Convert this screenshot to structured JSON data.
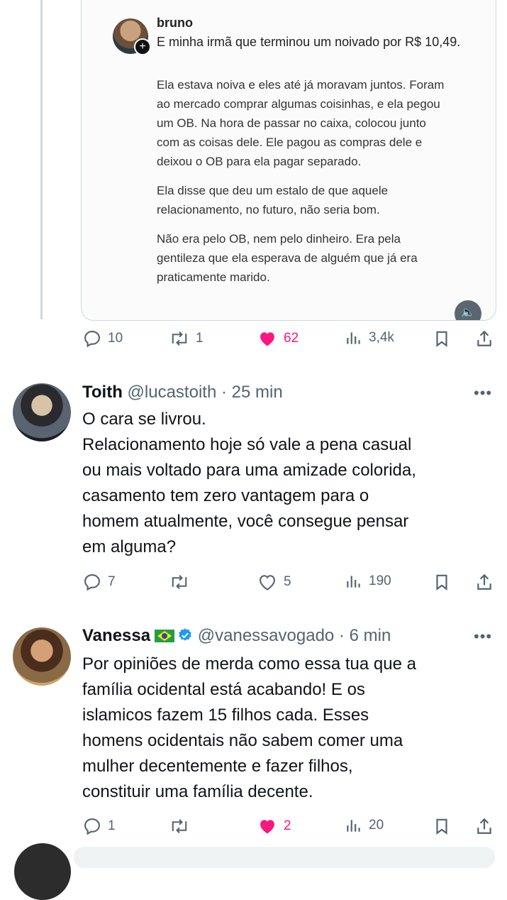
{
  "quoted": {
    "author": "bruno",
    "headline": "E minha irmã que terminou um noivado por R$ 10,49.",
    "paragraphs": [
      "Ela estava noiva e eles até já moravam juntos. Foram ao mercado comprar algumas coisinhas, e ela pegou um OB. Na hora de passar no caixa, colocou junto com as coisas dele. Ele pagou as compras dele e deixou o OB para ela pagar separado.",
      "Ela disse que deu um estalo de que aquele relacionamento, no futuro, não seria bom.",
      "Não era pelo OB, nem pelo dinheiro. Era pela gentileza que ela esperava de alguém que já era praticamente marido."
    ],
    "actions": {
      "replies": "10",
      "reposts": "1",
      "likes": "62",
      "views": "3,4k"
    }
  },
  "replies": [
    {
      "name": "Toith",
      "handle": "@lucastoith",
      "time": "· 25 min",
      "lines": [
        "O cara se livrou.",
        "Relacionamento hoje só vale a pena casual",
        "ou mais voltado para uma amizade colorida,",
        "casamento tem zero vantagem para o",
        "homem atualmente, você consegue pensar",
        "em alguma?"
      ],
      "actions": {
        "replies": "7",
        "reposts": "",
        "likes": "5",
        "views": "190"
      }
    },
    {
      "name": "Vanessa",
      "handle": "@vanessavogado",
      "time": "· 6 min",
      "lines": [
        "Por opiniões de merda como essa tua que a",
        "família ocidental está acabando! E os",
        "islamicos fazem 15 filhos cada. Esses",
        "homens ocidentais não sabem comer uma",
        "mulher decentemente e fazer filhos,",
        "constituir uma família decente."
      ],
      "actions": {
        "replies": "1",
        "reposts": "",
        "likes": "2",
        "views": "20"
      }
    }
  ],
  "colors": {
    "like": "#f91880",
    "muted": "#536471",
    "verified": "#1d9bf0",
    "thread_line": "#cfd9de"
  },
  "icons": [
    "reply-icon",
    "repost-icon",
    "heart-icon",
    "views-icon",
    "bookmark-icon",
    "share-icon",
    "more-icon",
    "verified-icon",
    "brazil-flag-icon",
    "volume-icon"
  ]
}
